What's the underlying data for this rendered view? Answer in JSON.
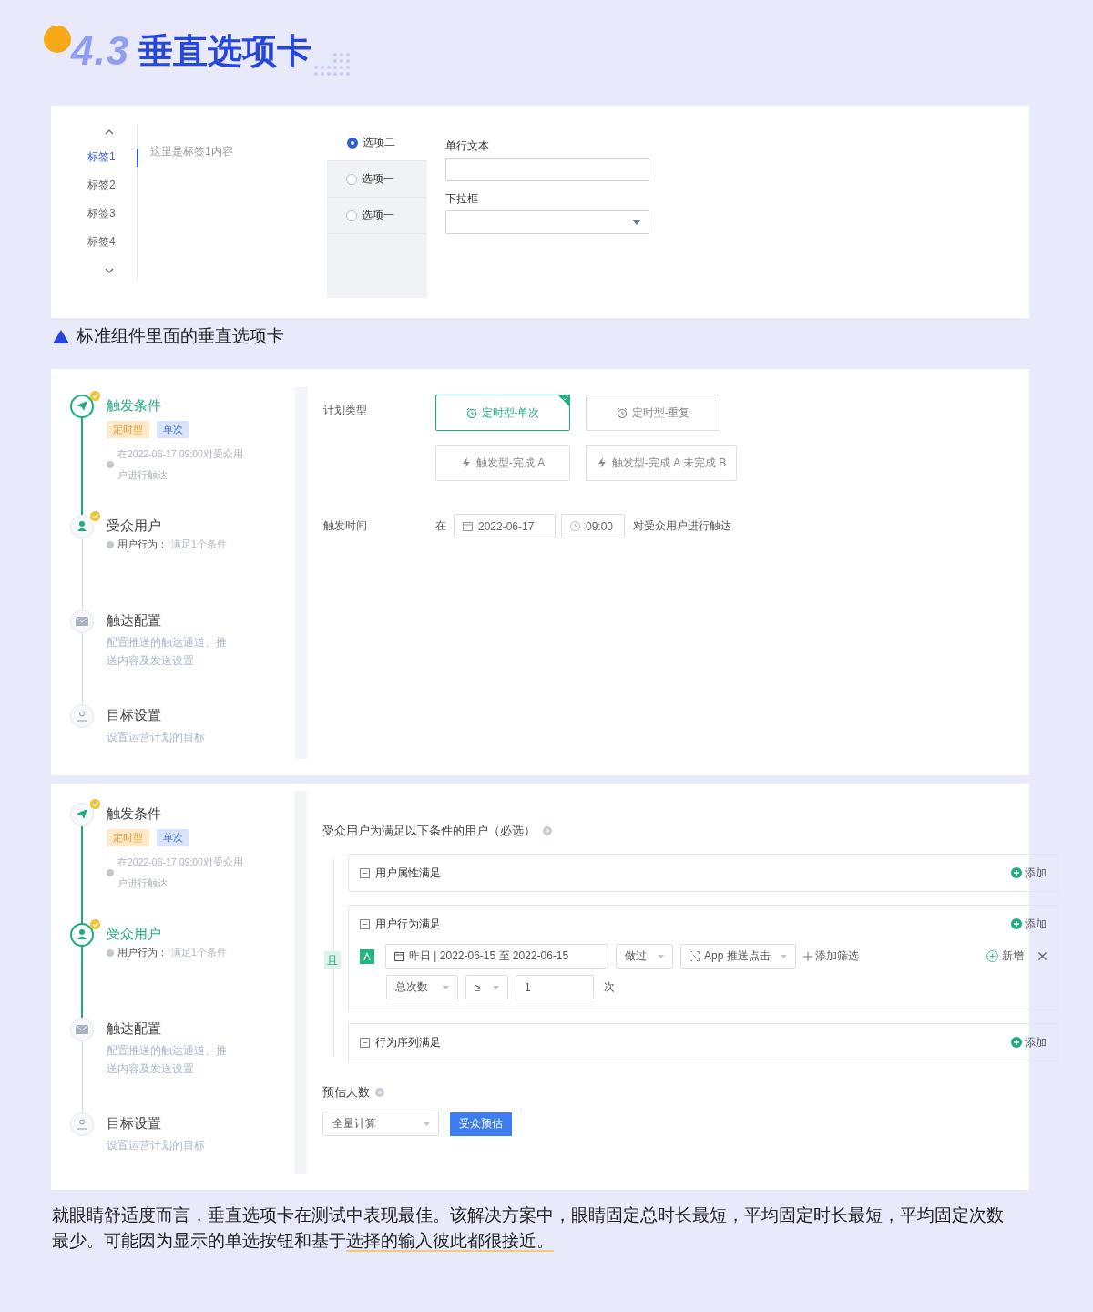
{
  "heading": {
    "number": "4.3",
    "title": "垂直选项卡"
  },
  "demo": {
    "tabs": [
      {
        "label": "标签1",
        "selected": true
      },
      {
        "label": "标签2",
        "selected": false
      },
      {
        "label": "标签3",
        "selected": false
      },
      {
        "label": "标签4",
        "selected": false
      }
    ],
    "tab_content": "这里是标签1内容",
    "radios": [
      {
        "label": "选项二",
        "selected": true
      },
      {
        "label": "选项一",
        "selected": false
      },
      {
        "label": "选项一",
        "selected": false
      }
    ],
    "text_field": {
      "label": "单行文本"
    },
    "dropdown": {
      "label": "下拉框"
    }
  },
  "caption": "标准组件里面的垂直选项卡",
  "plan_screen": {
    "steps": [
      {
        "title": "触发条件",
        "selected": true,
        "done": true,
        "tags": [
          {
            "label": "定时型",
            "color": "#fde9c8"
          },
          {
            "label": "单次",
            "color": "#d9e4fb"
          }
        ],
        "detail": "在2022-06-17 09:00对受众用户进行触达"
      },
      {
        "title": "受众用户",
        "selected": false,
        "done": true,
        "detail_label": "用户行为：",
        "detail": "满足1个条件"
      },
      {
        "title": "触达配置",
        "selected": false,
        "done": false,
        "description": "配置推送的触达通道、推送内容及发送设置"
      },
      {
        "title": "目标设置",
        "selected": false,
        "done": false,
        "description": "设置运营计划的目标"
      }
    ],
    "plan_type_label": "计划类型",
    "plan_types": [
      {
        "label": "定时型-单次",
        "kind": "scheduled",
        "selected": true
      },
      {
        "label": "定时型-重复",
        "kind": "scheduled",
        "selected": false
      },
      {
        "label": "触发型-完成 A",
        "kind": "triggered",
        "selected": false
      },
      {
        "label": "触发型-完成 A 未完成 B",
        "kind": "triggered",
        "selected": false
      }
    ],
    "trigger_time": {
      "label": "触发时间",
      "prefix": "在",
      "date": "2022-06-17",
      "time": "09:00",
      "suffix": "对受众用户进行触达"
    }
  },
  "audience_screen": {
    "steps": [
      {
        "title": "触发条件",
        "selected": false,
        "done": true,
        "tags": [
          {
            "label": "定时型",
            "color": "#fde9c8"
          },
          {
            "label": "单次",
            "color": "#d9e4fb"
          }
        ],
        "detail": "在2022-06-17 09:00对受众用户进行触达"
      },
      {
        "title": "受众用户",
        "selected": true,
        "done": true,
        "detail_label": "用户行为：",
        "detail": "满足1个条件"
      },
      {
        "title": "触达配置",
        "selected": false,
        "done": false,
        "description": "配置推送的触达通道、推送内容及发送设置"
      },
      {
        "title": "目标设置",
        "selected": false,
        "done": false,
        "description": "设置运营计划的目标"
      }
    ],
    "title": "受众用户为满足以下条件的用户（必选）",
    "connector": "且",
    "groups": [
      {
        "title": "用户属性满足",
        "add": "添加"
      },
      {
        "title": "用户行为满足",
        "add": "添加",
        "rule": {
          "letter": "A",
          "date_range": "昨日 | 2022-06-15 至 2022-06-15",
          "verb": "做过",
          "event": "App 推送点击",
          "add_filter": "添加筛选",
          "new": "新增",
          "metric": "总次数",
          "operator": "≥",
          "value": "1",
          "unit": "次"
        }
      },
      {
        "title": "行为序列满足",
        "add": "添加"
      }
    ],
    "estimate": {
      "label": "预估人数",
      "mode": "全量计算",
      "button": "受众预估"
    }
  },
  "paragraph": {
    "text": "就眼睛舒适度而言，垂直选项卡在测试中表现最佳。该解决方案中，眼睛固定总时长最短，平均固定时长最短，平均固定次数最少。可能因为显示的单选按钮和基于",
    "highlight": "选择的输入彼此都很接近。"
  }
}
